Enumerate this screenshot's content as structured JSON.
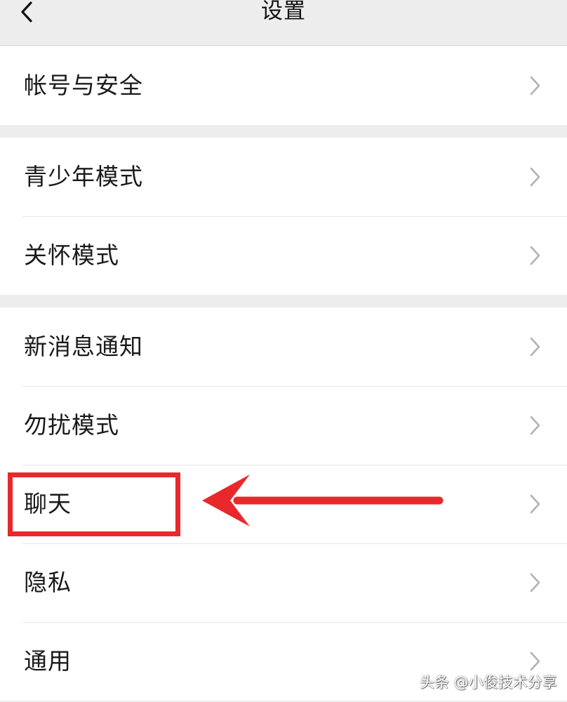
{
  "header": {
    "title": "设置",
    "back_icon": "chevron-left-icon"
  },
  "groups": [
    {
      "items": [
        {
          "label": "帐号与安全"
        }
      ]
    },
    {
      "items": [
        {
          "label": "青少年模式"
        },
        {
          "label": "关怀模式"
        }
      ]
    },
    {
      "items": [
        {
          "label": "新消息通知"
        },
        {
          "label": "勿扰模式"
        },
        {
          "label": "聊天"
        },
        {
          "label": "隐私"
        },
        {
          "label": "通用"
        }
      ]
    }
  ],
  "annotation": {
    "highlighted_item": "聊天",
    "color": "#e8282b"
  },
  "watermark": {
    "text": "头条 @小俊技术分享"
  },
  "colors": {
    "page_background": "#ededed",
    "cell_background": "#ffffff",
    "chevron": "#b2b2b2"
  }
}
